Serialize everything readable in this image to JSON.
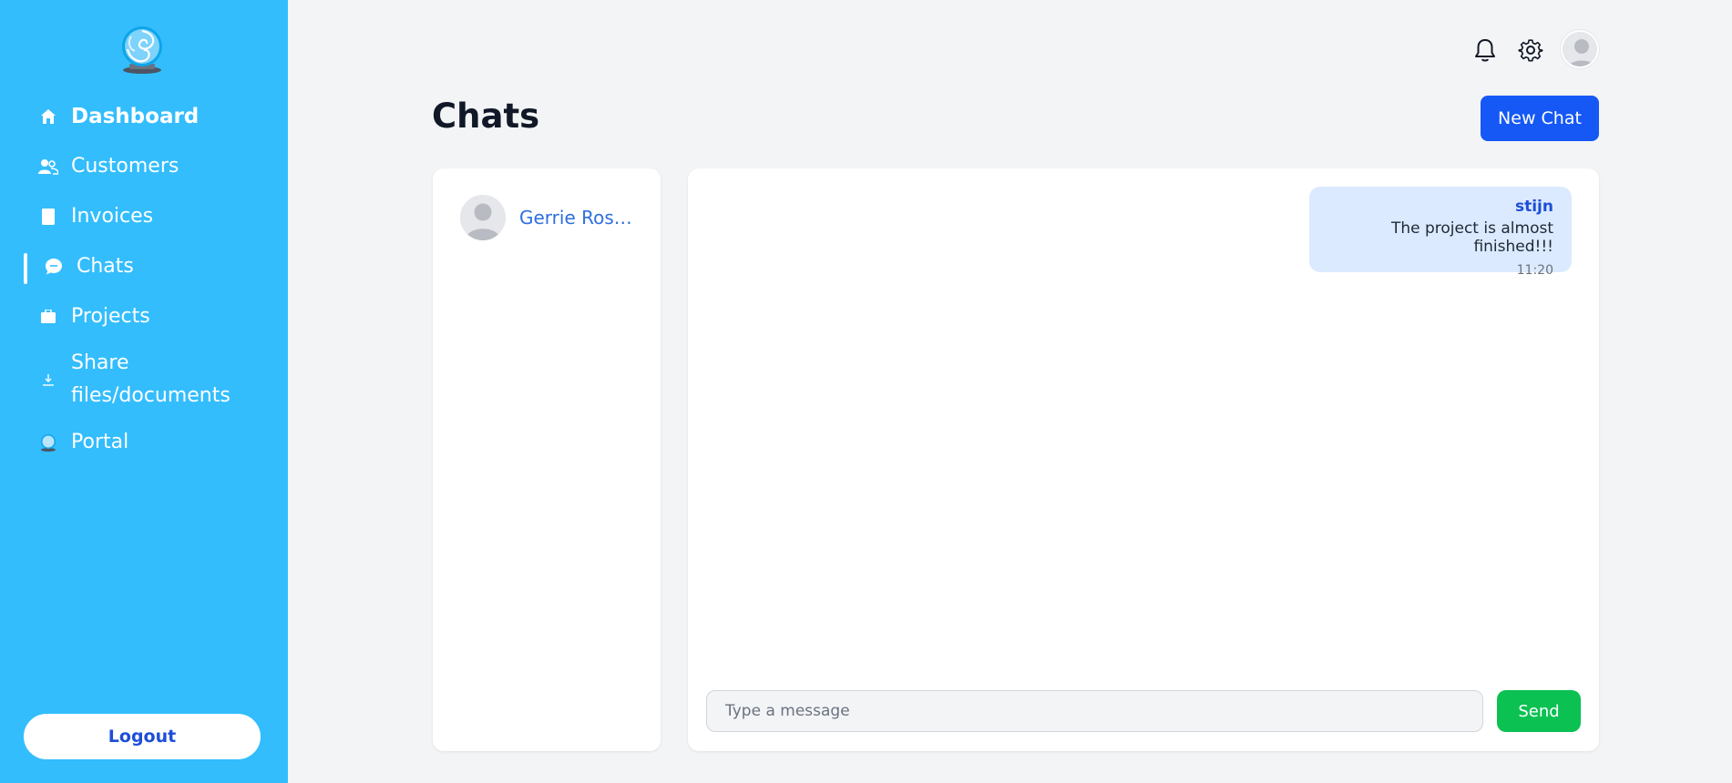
{
  "app": {
    "logo_icon": "portal-globe-logo",
    "accent_color": "#33bdfd",
    "primary_button_color": "#1558f5",
    "send_button_color": "#0bc152"
  },
  "sidebar": {
    "items": [
      {
        "label": "Dashboard",
        "icon": "home-icon"
      },
      {
        "label": "Customers",
        "icon": "users-icon"
      },
      {
        "label": "Invoices",
        "icon": "document-icon"
      },
      {
        "label": "Chats",
        "icon": "chat-bubble-icon",
        "active": true
      },
      {
        "label": "Projects",
        "icon": "briefcase-icon"
      },
      {
        "label": "Share files/documents",
        "icon": "download-icon"
      },
      {
        "label": "Portal",
        "icon": "globe-icon"
      }
    ],
    "logout_label": "Logout"
  },
  "header": {
    "notification_icon": "bell-icon",
    "settings_icon": "gear-icon",
    "avatar_icon": "user-avatar"
  },
  "main": {
    "title": "Chats",
    "new_chat_label": "New Chat"
  },
  "contacts": [
    {
      "name": "Gerrie Rossouw"
    }
  ],
  "conversation": {
    "messages": [
      {
        "sender": "stijn",
        "text": "The project is almost finished!!!",
        "time": "11:20"
      }
    ],
    "input_placeholder": "Type a message",
    "input_value": "",
    "send_label": "Send"
  }
}
